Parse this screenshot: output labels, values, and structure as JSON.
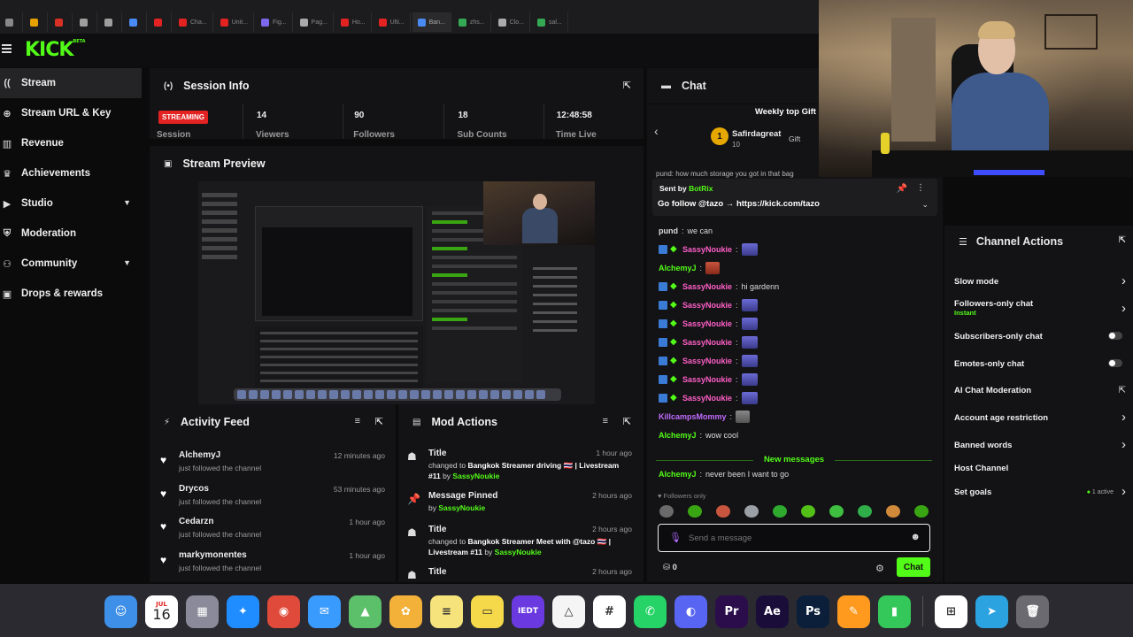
{
  "browser": {
    "tabs": [
      {
        "label": "",
        "color": "#888888"
      },
      {
        "label": "",
        "color": "#e6a100"
      },
      {
        "label": "",
        "color": "#d93025"
      },
      {
        "label": "",
        "color": "#9e9e9e"
      },
      {
        "label": "",
        "color": "#9e9e9e"
      },
      {
        "label": "",
        "color": "#4a8af4"
      },
      {
        "label": "",
        "color": "#e32222"
      },
      {
        "label": "Cha...",
        "color": "#e32222"
      },
      {
        "label": "Unit...",
        "color": "#e32222"
      },
      {
        "label": "Fig...",
        "color": "#7b68ee"
      },
      {
        "label": "Pag...",
        "color": "#aaaaaa"
      },
      {
        "label": "Ho...",
        "color": "#e32222"
      },
      {
        "label": "Ulti...",
        "color": "#e32222"
      },
      {
        "label": "Ban...",
        "color": "#4a8af4"
      },
      {
        "label": "zhs...",
        "color": "#34a853"
      },
      {
        "label": "Clo...",
        "color": "#aaaaaa"
      },
      {
        "label": "sal...",
        "color": "#34a853"
      }
    ]
  },
  "brand": {
    "logo": "KICK",
    "beta": "BETA",
    "accent": "#53fc18"
  },
  "sidebar": {
    "items": [
      {
        "label": "Stream",
        "icon": "broadcast-icon",
        "active": true
      },
      {
        "label": "Stream URL & Key",
        "icon": "globe-icon"
      },
      {
        "label": "Revenue",
        "icon": "chart-bar-icon"
      },
      {
        "label": "Achievements",
        "icon": "trophy-icon"
      },
      {
        "label": "Studio",
        "icon": "camera-icon",
        "chevron": true
      },
      {
        "label": "Moderation",
        "icon": "shield-icon"
      },
      {
        "label": "Community",
        "icon": "people-icon",
        "chevron": true
      },
      {
        "label": "Drops & rewards",
        "icon": "gift-icon"
      }
    ]
  },
  "session": {
    "title": "Session Info",
    "status_badge": "STREAMING",
    "status_label": "Session",
    "stats": [
      {
        "value": "14",
        "label": "Viewers"
      },
      {
        "value": "90",
        "label": "Followers"
      },
      {
        "value": "18",
        "label": "Sub Counts"
      },
      {
        "value": "12:48:58",
        "label": "Time Live"
      }
    ]
  },
  "preview": {
    "title": "Stream Preview"
  },
  "activity": {
    "title": "Activity Feed",
    "items": [
      {
        "name": "AlchemyJ",
        "desc": "just followed the channel",
        "time": "12 minutes ago"
      },
      {
        "name": "Drycos",
        "desc": "just followed the channel",
        "time": "53 minutes ago"
      },
      {
        "name": "Cedarzn",
        "desc": "just followed the channel",
        "time": "1 hour ago"
      },
      {
        "name": "markymonentes",
        "desc": "just followed the channel",
        "time": "1 hour ago"
      }
    ]
  },
  "mod": {
    "title": "Mod Actions",
    "items": [
      {
        "title": "Title",
        "time": "1 hour ago",
        "pre": "changed to ",
        "bold": "Bangkok Streamer driving 🇹🇭 | Livestream #11",
        "by": " by ",
        "user": "SassyNoukie",
        "icon": "person-id-icon"
      },
      {
        "title": "Message Pinned",
        "time": "2 hours ago",
        "pre": "",
        "bold": "",
        "by": "by ",
        "user": "SassyNoukie",
        "icon": "pin-icon"
      },
      {
        "title": "Title",
        "time": "2 hours ago",
        "pre": "changed to ",
        "bold": "Bangkok Streamer Meet with @tazo 🇹🇭 | Livestream #11",
        "by": " by ",
        "user": "SassyNoukie",
        "icon": "person-id-icon"
      },
      {
        "title": "Title",
        "time": "2 hours ago",
        "pre": "",
        "bold": "",
        "by": "",
        "user": "",
        "icon": "person-id-icon"
      }
    ]
  },
  "chat": {
    "title": "Chat",
    "gift_title": "Weekly top Gift",
    "gift_user": "Safirdagreat",
    "gift_rank": "1",
    "gift_count": "10",
    "gift_chip": "Gift",
    "partial_line": "pund: how much storage you got in that bag",
    "pinned_label": "Sent by",
    "pinned_user": "BotRix",
    "pinned_msg": "Go follow @tazo → https://kick.com/tazo",
    "messages": [
      {
        "user": "pund",
        "color": "#dddddd",
        "text": "we can",
        "badges": false,
        "emote": ""
      },
      {
        "user": "SassyNoukie",
        "color": "#ff5fc8",
        "text": "",
        "badges": true,
        "emote": "emote"
      },
      {
        "user": "AlchemyJ",
        "color": "#53fc18",
        "text": "",
        "badges": false,
        "emote": "red"
      },
      {
        "user": "SassyNoukie",
        "color": "#ff5fc8",
        "text": "hi gardenn",
        "badges": true,
        "emote": ""
      },
      {
        "user": "SassyNoukie",
        "color": "#ff5fc8",
        "text": "",
        "badges": true,
        "emote": "emote"
      },
      {
        "user": "SassyNoukie",
        "color": "#ff5fc8",
        "text": "",
        "badges": true,
        "emote": "emote"
      },
      {
        "user": "SassyNoukie",
        "color": "#ff5fc8",
        "text": "",
        "badges": true,
        "emote": "emote"
      },
      {
        "user": "SassyNoukie",
        "color": "#ff5fc8",
        "text": "",
        "badges": true,
        "emote": "emote"
      },
      {
        "user": "SassyNoukie",
        "color": "#ff5fc8",
        "text": "",
        "badges": true,
        "emote": "emote"
      },
      {
        "user": "SassyNoukie",
        "color": "#ff5fc8",
        "text": "",
        "badges": true,
        "emote": "emote"
      },
      {
        "user": "KillcampsMommy",
        "color": "#c06bff",
        "text": "",
        "badges": false,
        "emote": "cat"
      },
      {
        "user": "AlchemyJ",
        "color": "#53fc18",
        "text": "wow cool",
        "badges": false,
        "emote": ""
      }
    ],
    "new_messages": "New messages",
    "last_message": {
      "user": "AlchemyJ",
      "color": "#53fc18",
      "text": "never been I want to go"
    },
    "followers_only": "Followers only",
    "input_placeholder": "Send a message",
    "points": "0",
    "send_label": "Chat"
  },
  "channel_actions": {
    "title": "Channel Actions",
    "items": [
      {
        "label": "Slow mode",
        "sub": "",
        "control": "chevron"
      },
      {
        "label": "Followers-only chat",
        "sub": "Instant",
        "control": "chevron"
      },
      {
        "label": "Subscribers-only chat",
        "sub": "",
        "control": "toggle"
      },
      {
        "label": "Emotes-only chat",
        "sub": "",
        "control": "toggle"
      },
      {
        "label": "AI Chat Moderation",
        "sub": "",
        "control": "external"
      },
      {
        "label": "Account age restriction",
        "sub": "",
        "control": "chevron"
      },
      {
        "label": "Banned words",
        "sub": "",
        "control": "chevron"
      },
      {
        "label": "Host Channel",
        "sub": "",
        "control": "none"
      },
      {
        "label": "Set goals",
        "sub": "",
        "control": "chevron",
        "tag": "1 active"
      }
    ]
  },
  "dock": {
    "calendar_month": "JUL",
    "calendar_day": "16",
    "apps": [
      {
        "name": "finder-icon",
        "color": "#3d8fe8",
        "glyph": "☺"
      },
      {
        "name": "calendar-icon",
        "color": "#ffffff",
        "glyph": ""
      },
      {
        "name": "launchpad-icon",
        "color": "#8a8a9a",
        "glyph": "▦"
      },
      {
        "name": "safari-icon",
        "color": "#1f8cff",
        "glyph": "✦"
      },
      {
        "name": "chrome-icon",
        "color": "#e04a3a",
        "glyph": "◉"
      },
      {
        "name": "mail-icon",
        "color": "#3a9bff",
        "glyph": "✉"
      },
      {
        "name": "maps-icon",
        "color": "#5cbf6a",
        "glyph": "▲"
      },
      {
        "name": "photos-icon",
        "color": "#f4b13a",
        "glyph": "✿"
      },
      {
        "name": "notes-icon",
        "color": "#f7e37c",
        "glyph": "≡"
      },
      {
        "name": "stickies-icon",
        "color": "#f5d94a",
        "glyph": "▭"
      },
      {
        "name": "ieot-icon",
        "color": "#6a3ae0",
        "glyph": "IEDT"
      },
      {
        "name": "google-drive-icon",
        "color": "#f5f5f5",
        "glyph": "△"
      },
      {
        "name": "slack-icon",
        "color": "#ffffff",
        "glyph": "#"
      },
      {
        "name": "whatsapp-icon",
        "color": "#25d366",
        "glyph": "✆"
      },
      {
        "name": "discord-icon",
        "color": "#5865f2",
        "glyph": "◐"
      },
      {
        "name": "premiere-icon",
        "color": "#2a0d4a",
        "glyph": "Pr"
      },
      {
        "name": "after-effects-icon",
        "color": "#1a0d3a",
        "glyph": "Ae"
      },
      {
        "name": "photoshop-icon",
        "color": "#0b1f3a",
        "glyph": "Ps"
      },
      {
        "name": "pencil-app-icon",
        "color": "#ff9a1f",
        "glyph": "✎"
      },
      {
        "name": "numbers-icon",
        "color": "#34c759",
        "glyph": "▮"
      },
      {
        "name": "windows-app-icon",
        "color": "#ffffff",
        "glyph": "⊞"
      },
      {
        "name": "telegram-icon",
        "color": "#2aa3e0",
        "glyph": "➤"
      },
      {
        "name": "trash-icon",
        "color": "#6a6a70",
        "glyph": "🗑"
      }
    ]
  }
}
